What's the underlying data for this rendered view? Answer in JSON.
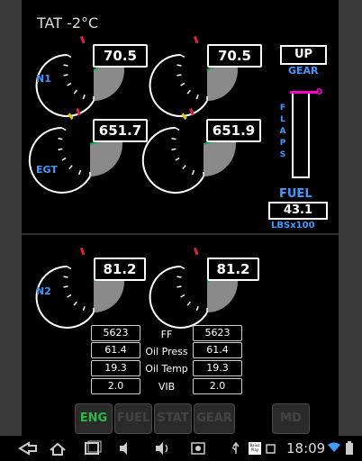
{
  "header": {
    "tat": "TAT -2°C"
  },
  "engines": {
    "n1": {
      "label": "N1",
      "left": "70.5",
      "right": "70.5"
    },
    "egt": {
      "label": "EGT",
      "left": "651.7",
      "right": "651.9"
    },
    "n2": {
      "label": "N2",
      "left": "81.2",
      "right": "81.2"
    }
  },
  "gear": {
    "value": "UP",
    "label": "GEAR"
  },
  "flaps": {
    "label_letters": [
      "F",
      "L",
      "A",
      "P",
      "S"
    ],
    "value": "0",
    "accent_color": "#ff00cc"
  },
  "fuel": {
    "label": "FUEL",
    "value": "43.1",
    "unit": "LBSx100"
  },
  "table": {
    "rows": [
      {
        "label": "FF",
        "left": "5623",
        "right": "5623"
      },
      {
        "label": "Oil Press",
        "left": "61.4",
        "right": "61.4"
      },
      {
        "label": "Oil Temp",
        "left": "19.3",
        "right": "19.3"
      },
      {
        "label": "VIB",
        "left": "2.0",
        "right": "2.0"
      }
    ]
  },
  "tabs": [
    {
      "label": "ENG",
      "active": true
    },
    {
      "label": "FUEL",
      "active": false
    },
    {
      "label": "STAT",
      "active": false
    },
    {
      "label": "GEAR",
      "active": false
    },
    {
      "label": "MD",
      "active": false
    }
  ],
  "statusbar": {
    "time": "18:09",
    "store_label": "Baixa\nPlay"
  },
  "colors": {
    "label_blue": "#3e9bff",
    "active_tab_green": "#2db84a",
    "needle_green": "#1ea64a",
    "redline": "#e02040",
    "warn_yellow": "#e6c800"
  }
}
